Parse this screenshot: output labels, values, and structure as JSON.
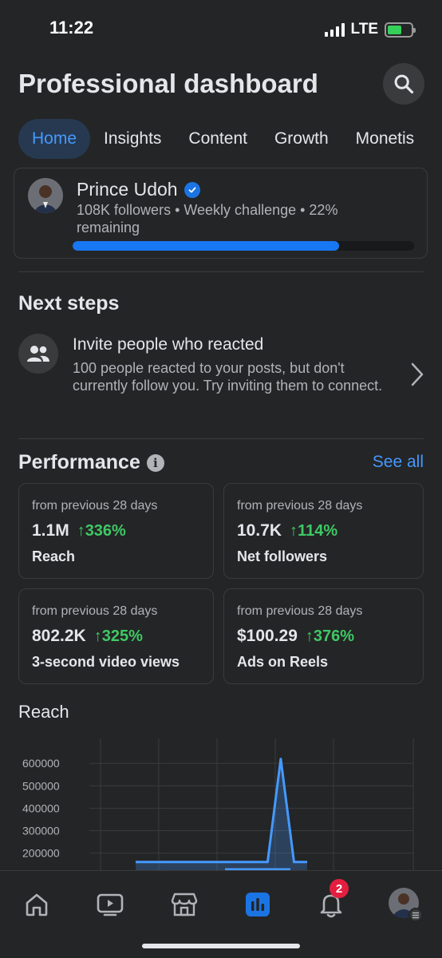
{
  "status_bar": {
    "time": "11:22",
    "network": "LTE"
  },
  "header": {
    "title": "Professional dashboard"
  },
  "tabs": [
    {
      "label": "Home",
      "active": true
    },
    {
      "label": "Insights",
      "active": false
    },
    {
      "label": "Content",
      "active": false
    },
    {
      "label": "Growth",
      "active": false
    },
    {
      "label": "Monetis",
      "active": false
    }
  ],
  "profile": {
    "name": "Prince Udoh",
    "subtitle": "108K followers • Weekly challenge • 22% remaining",
    "progress": 0.78
  },
  "next_steps": {
    "title": "Next steps",
    "item": {
      "title": "Invite people who reacted",
      "description": "100 people reacted to your posts, but don't currently follow you. Try inviting them to connect."
    }
  },
  "performance": {
    "title": "Performance",
    "see_all": "See all",
    "cards": [
      {
        "period": "from previous 28 days",
        "value": "1.1M",
        "change": "↑336%",
        "label": "Reach"
      },
      {
        "period": "from previous 28 days",
        "value": "10.7K",
        "change": "↑114%",
        "label": "Net followers"
      },
      {
        "period": "from previous 28 days",
        "value": "802.2K",
        "change": "↑325%",
        "label": "3-second video views"
      },
      {
        "period": "from previous 28 days",
        "value": "$100.29",
        "change": "↑376%",
        "label": "Ads on Reels"
      }
    ]
  },
  "chart_data": {
    "type": "area",
    "title": "Reach",
    "yticks": [
      "600000",
      "500000",
      "400000",
      "300000",
      "200000"
    ],
    "ylim": [
      170000,
      640000
    ],
    "x": [
      0,
      1,
      2,
      3,
      4,
      5,
      6,
      7,
      8,
      9,
      10,
      11,
      12,
      13
    ],
    "values": [
      160000,
      160000,
      160000,
      160000,
      160000,
      160000,
      160000,
      160000,
      160000,
      160000,
      160000,
      620000,
      160000,
      160000
    ],
    "grid": true,
    "color": "#4599ff"
  },
  "bottom_nav": {
    "items": [
      {
        "icon": "home-icon",
        "active": false
      },
      {
        "icon": "video-icon",
        "active": false
      },
      {
        "icon": "marketplace-icon",
        "active": false
      },
      {
        "icon": "dashboard-icon",
        "active": true
      },
      {
        "icon": "bell-icon",
        "active": false,
        "badge": "2"
      },
      {
        "icon": "profile-avatar",
        "active": false
      }
    ]
  },
  "colors": {
    "background": "#242526",
    "accent": "#4599ff",
    "positive": "#3ec964",
    "badge": "#e41e3f"
  }
}
